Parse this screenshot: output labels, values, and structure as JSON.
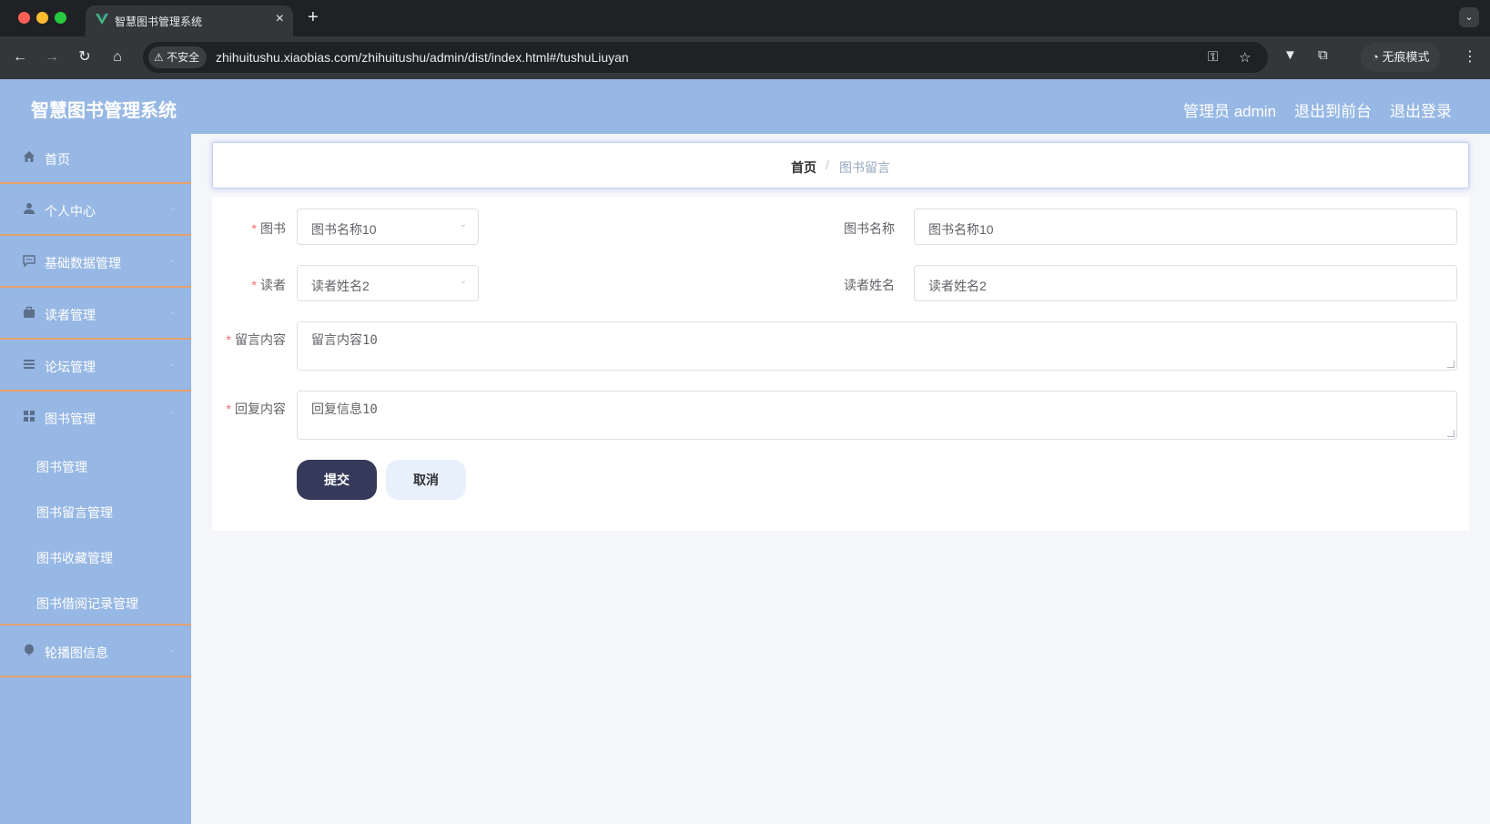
{
  "browser": {
    "tab_title": "智慧图书管理系统",
    "url": "zhihuitushu.xiaobias.com/zhihuitushu/admin/dist/index.html#/tushuLiuyan",
    "security_label": "不安全",
    "incognito_label": "无痕模式"
  },
  "header": {
    "title": "智慧图书管理系统",
    "admin_label": "管理员 admin",
    "front_label": "退出到前台",
    "logout_label": "退出登录"
  },
  "sidebar": {
    "items": [
      {
        "label": "首页",
        "icon": "home-icon"
      },
      {
        "label": "个人中心",
        "icon": "user-icon"
      },
      {
        "label": "基础数据管理",
        "icon": "message-icon"
      },
      {
        "label": "读者管理",
        "icon": "briefcase-icon"
      },
      {
        "label": "论坛管理",
        "icon": "list-icon"
      },
      {
        "label": "图书管理",
        "icon": "grid-icon"
      },
      {
        "label": "轮播图信息",
        "icon": "balloon-icon"
      }
    ],
    "subitems": [
      {
        "label": "图书管理"
      },
      {
        "label": "图书留言管理"
      },
      {
        "label": "图书收藏管理"
      },
      {
        "label": "图书借阅记录管理"
      }
    ]
  },
  "breadcrumb": {
    "home": "首页",
    "separator": "/",
    "current": "图书留言"
  },
  "form": {
    "book_label": "图书",
    "book_value": "图书名称10",
    "book_name_label": "图书名称",
    "book_name_value": "图书名称10",
    "reader_label": "读者",
    "reader_value": "读者姓名2",
    "reader_name_label": "读者姓名",
    "reader_name_value": "读者姓名2",
    "message_label": "留言内容",
    "message_value": "留言内容10",
    "reply_label": "回复内容",
    "reply_value": "回复信息10",
    "required_mark": "*",
    "submit_label": "提交",
    "cancel_label": "取消"
  },
  "colors": {
    "header_bg": "#97b8e4",
    "sidebar_divider": "#e7a06d",
    "submit_bg": "#353a5a",
    "cancel_bg": "#e8f0fc",
    "required": "#f56c6c"
  }
}
